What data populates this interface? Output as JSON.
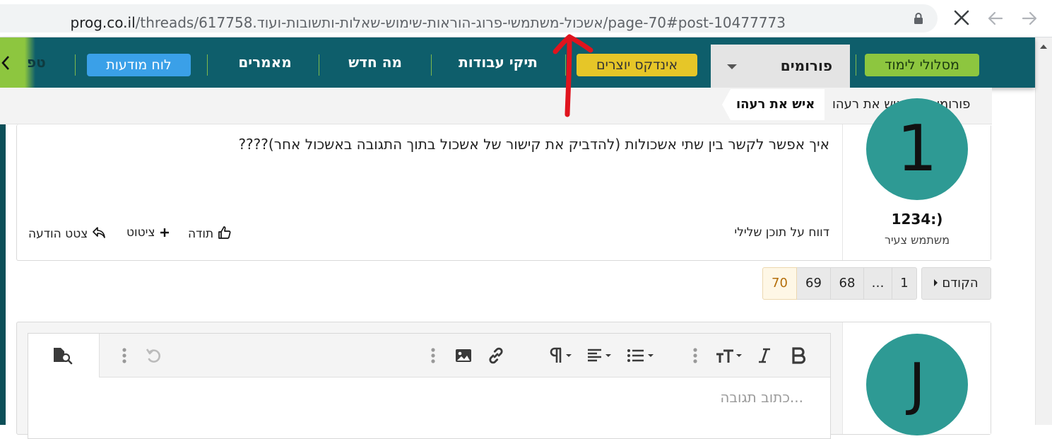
{
  "browser": {
    "url_host": "prog.co.il",
    "url_path": "/threads/617758.אשכול-משתמשי-פרוג-הוראות-שימוש-שאלות-ותשובות-ועוד/page-70#post-10477773"
  },
  "nav": {
    "cut_item": "טפ",
    "notice_board": "לוח מודעות",
    "articles": "מאמרים",
    "whats_new": "מה חדש",
    "portfolios": "תיקי עבודות",
    "creators_index": "אינדקס יוצרים",
    "forums": "פורומים",
    "learning_paths": "מסלולי לימוד"
  },
  "breadcrumb": {
    "items": [
      "פורומים",
      "איש את רעהו"
    ],
    "current": "איש את רעהו"
  },
  "post1": {
    "avatar_letter": "1",
    "username": "1234:)",
    "user_title": "משתמש צעיר",
    "body": "איך אפשר לקשר בין שתי אשכולות (להדביק את קישור של אשכול בתוך התגובה באשכול אחר)????",
    "report": "דווח על תוכן שלילי",
    "like": "תודה",
    "quote": "ציטוט",
    "reply_quote": "צטט הודעה"
  },
  "pagination": {
    "prev": "הקודם",
    "pages": [
      "1",
      "…",
      "68",
      "69",
      "70"
    ],
    "current": "70"
  },
  "editor": {
    "avatar_letter": "J",
    "placeholder": "כתוב תגובה..."
  },
  "colors": {
    "nav_bg": "#0e5e6b",
    "avatar": "#2e9a94",
    "accent_green": "#8dc63f",
    "accent_yellow": "#e6c628",
    "accent_blue": "#3aa0e8",
    "annotation_arrow": "#e0141e"
  }
}
